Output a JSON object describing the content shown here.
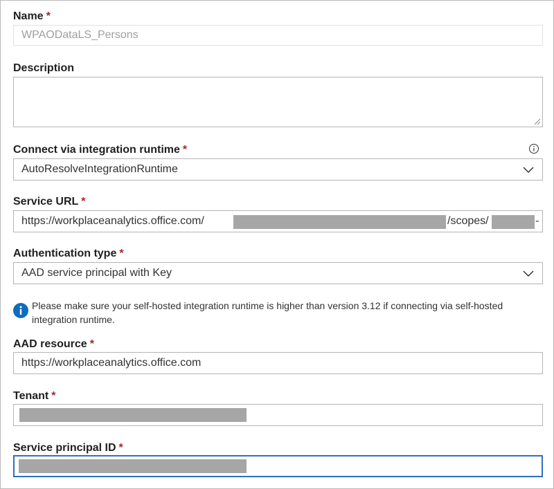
{
  "form": {
    "name": {
      "label": "Name",
      "value": "WPAODataLS_Persons"
    },
    "description": {
      "label": "Description",
      "value": ""
    },
    "runtime": {
      "label": "Connect via integration runtime",
      "value": "AutoResolveIntegrationRuntime"
    },
    "service_url": {
      "label": "Service URL",
      "prefix": "https://workplaceanalytics.office.com/",
      "middle": "/scopes/",
      "suffix": "-"
    },
    "auth_type": {
      "label": "Authentication type",
      "value": "AAD service principal with Key"
    },
    "notice": {
      "text": "Please make sure your self-hosted integration runtime is higher than version 3.12 if connecting via self-hosted integration runtime."
    },
    "aad_resource": {
      "label": "AAD resource",
      "value": "https://workplaceanalytics.office.com"
    },
    "tenant": {
      "label": "Tenant"
    },
    "sp_id": {
      "label": "Service principal ID"
    },
    "required_mark": "*"
  },
  "icons": {
    "info": "info-icon",
    "chevron": "chevron-down-icon",
    "resize": "resize-grip-icon"
  },
  "colors": {
    "required": "#a4262c",
    "focus": "#2b6fca",
    "info_fill": "#0f6cbd",
    "redaction": "#a6a6a6"
  }
}
